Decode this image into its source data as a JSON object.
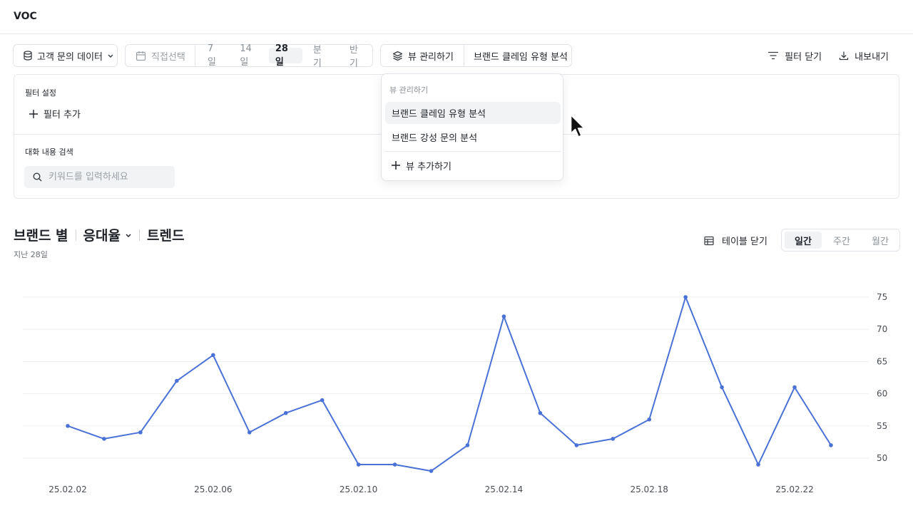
{
  "app": {
    "title": "VOC"
  },
  "toolbar": {
    "dataset_label": "고객 문의 데이터",
    "custom_range_label": "직접선택",
    "range_options": [
      "7일",
      "14일",
      "28일",
      "분기",
      "반기"
    ],
    "active_range": "28일",
    "view_manage_label": "뷰 관리하기",
    "current_view": "브랜드 클레임 유형 분석",
    "close_filter_label": "필터 닫기",
    "export_label": "내보내기"
  },
  "filter_panel": {
    "settings_label": "필터 설정",
    "add_filter_label": "필터 추가",
    "search_label": "대화 내용 검색",
    "search_placeholder": "키워드를 입력하세요"
  },
  "view_dropdown": {
    "header": "뷰 관리하기",
    "items": [
      "브랜드 클레임 유형 분석",
      "브랜드 강성 문의 분석"
    ],
    "hovered_item": "브랜드 클레임 유형 분석",
    "add_label": "뷰 추가하기"
  },
  "section": {
    "title_group": "브랜드 별",
    "title_metric": "응대율",
    "title_trend": "트렌드",
    "subtitle": "지난 28일",
    "table_toggle_label": "테이블 닫기",
    "granularity_options": [
      "일간",
      "주간",
      "월간"
    ],
    "active_granularity": "일간"
  },
  "colors": {
    "line": "#4a72d6",
    "grid": "#eceef1",
    "axis_text": "#4a4f55"
  },
  "chart_data": {
    "type": "line",
    "title": "",
    "xlabel": "",
    "ylabel": "",
    "x": [
      "25.02.02",
      "25.02.03",
      "25.02.04",
      "25.02.05",
      "25.02.06",
      "25.02.07",
      "25.02.08",
      "25.02.09",
      "25.02.10",
      "25.02.11",
      "25.02.12",
      "25.02.13",
      "25.02.14",
      "25.02.15",
      "25.02.16",
      "25.02.17",
      "25.02.18",
      "25.02.19",
      "25.02.20",
      "25.02.21",
      "25.02.22",
      "25.02.23"
    ],
    "x_tick_labels": [
      "25.02.02",
      "25.02.06",
      "25.02.10",
      "25.02.14",
      "25.02.18",
      "25.02.22"
    ],
    "series": [
      {
        "values": [
          55,
          53,
          54,
          62,
          66,
          54,
          57,
          59,
          49,
          49,
          48,
          52,
          72,
          57,
          52,
          53,
          56,
          75,
          61,
          49,
          61,
          52
        ]
      }
    ],
    "y_ticks": [
      50,
      55,
      60,
      65,
      70,
      75
    ],
    "ylim": [
      48,
      75
    ],
    "y_axis_side": "right",
    "grid": true,
    "legend": "none"
  }
}
